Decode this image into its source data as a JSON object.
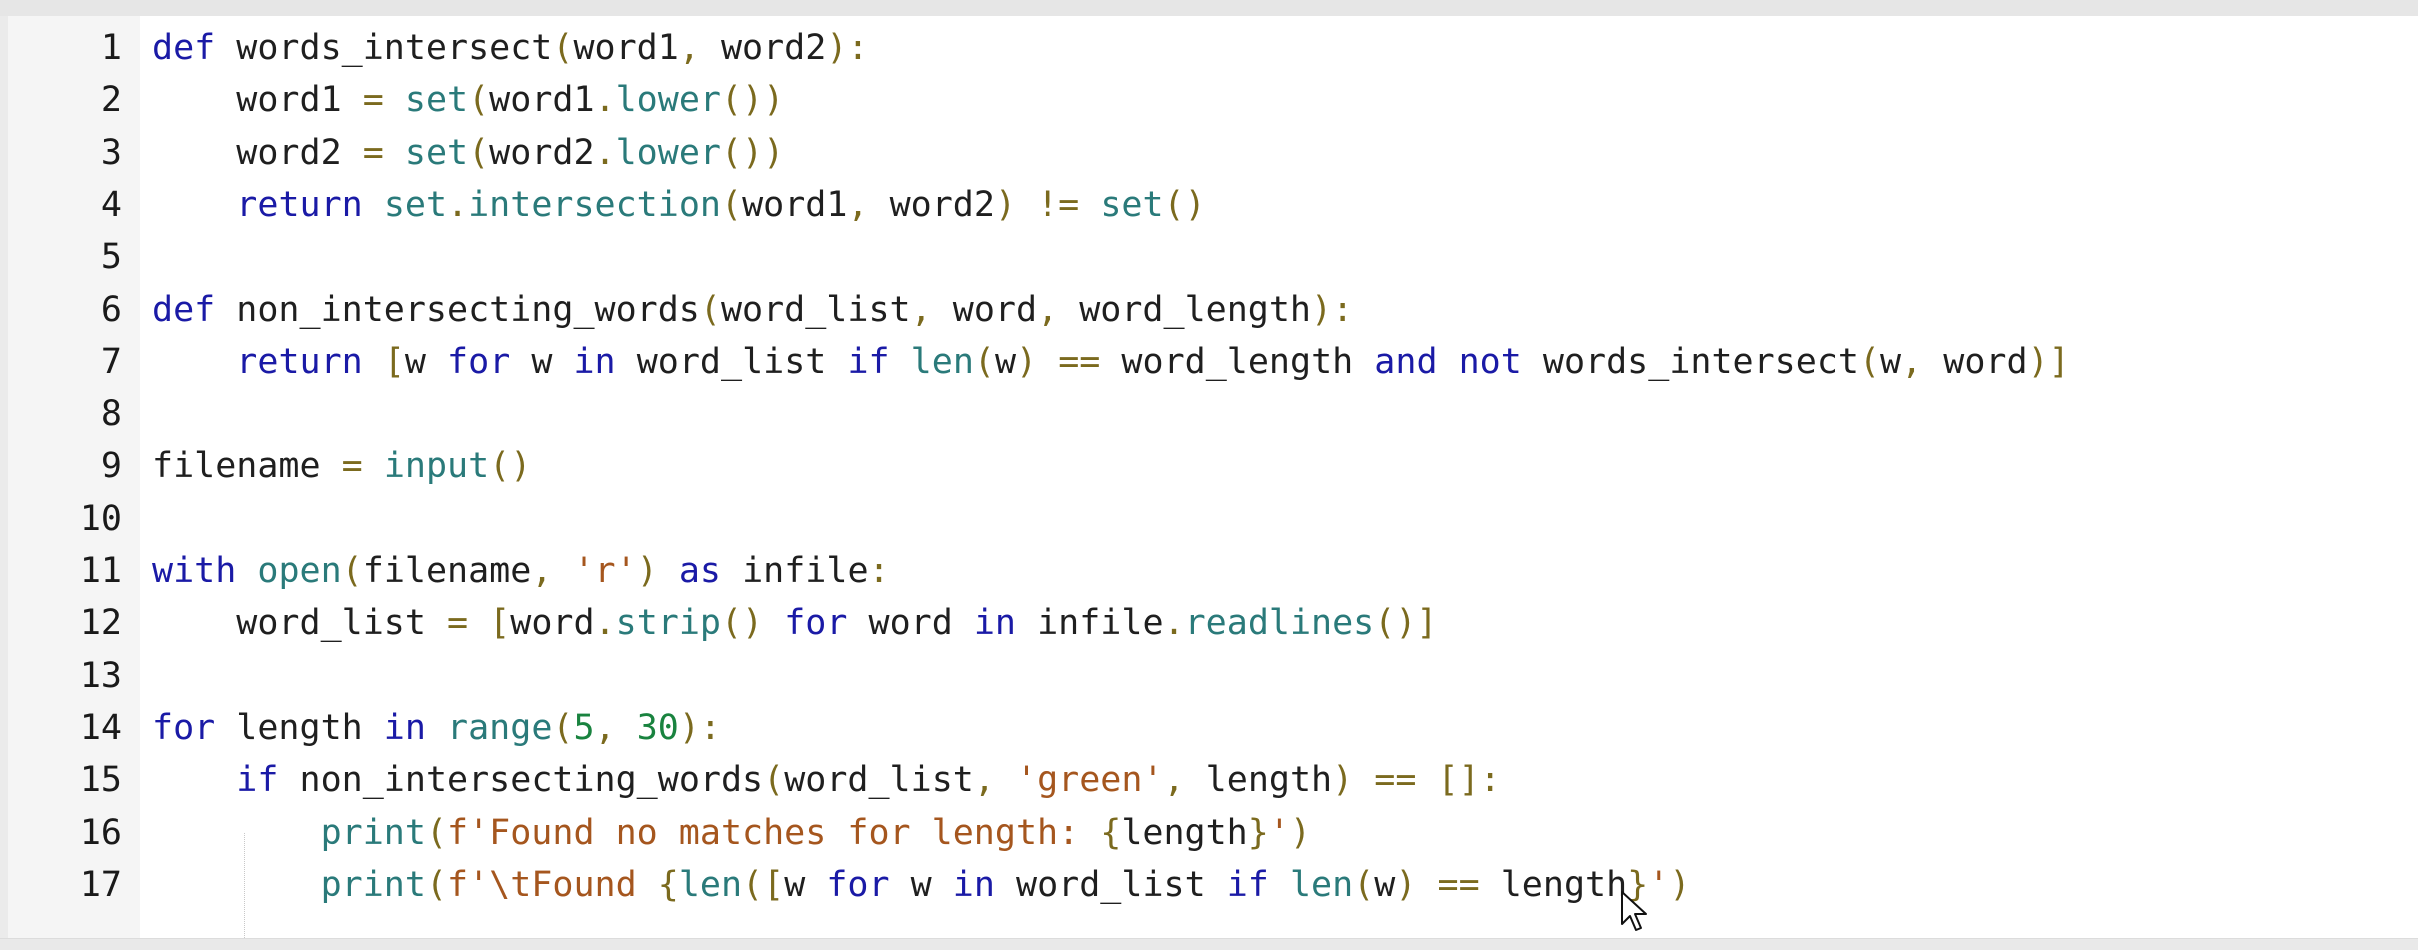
{
  "editor": {
    "lines": [
      {
        "num": "1",
        "tokens": [
          {
            "t": "def",
            "c": "kw"
          },
          {
            "t": " words_intersect",
            "c": "fn"
          },
          {
            "t": "(",
            "c": "pn"
          },
          {
            "t": "word1",
            "c": "tx"
          },
          {
            "t": ", ",
            "c": "pn"
          },
          {
            "t": "word2",
            "c": "tx"
          },
          {
            "t": "):",
            "c": "pn"
          }
        ]
      },
      {
        "num": "2",
        "tokens": [
          {
            "t": "    word1 ",
            "c": "tx"
          },
          {
            "t": "=",
            "c": "op"
          },
          {
            "t": " ",
            "c": "tx"
          },
          {
            "t": "set",
            "c": "bi"
          },
          {
            "t": "(",
            "c": "pn"
          },
          {
            "t": "word1",
            "c": "tx"
          },
          {
            "t": ".",
            "c": "pn"
          },
          {
            "t": "lower",
            "c": "bi"
          },
          {
            "t": "())",
            "c": "pn"
          }
        ]
      },
      {
        "num": "3",
        "tokens": [
          {
            "t": "    word2 ",
            "c": "tx"
          },
          {
            "t": "=",
            "c": "op"
          },
          {
            "t": " ",
            "c": "tx"
          },
          {
            "t": "set",
            "c": "bi"
          },
          {
            "t": "(",
            "c": "pn"
          },
          {
            "t": "word2",
            "c": "tx"
          },
          {
            "t": ".",
            "c": "pn"
          },
          {
            "t": "lower",
            "c": "bi"
          },
          {
            "t": "())",
            "c": "pn"
          }
        ]
      },
      {
        "num": "4",
        "tokens": [
          {
            "t": "    ",
            "c": "tx"
          },
          {
            "t": "return",
            "c": "kw"
          },
          {
            "t": " ",
            "c": "tx"
          },
          {
            "t": "set",
            "c": "bi"
          },
          {
            "t": ".",
            "c": "pn"
          },
          {
            "t": "intersection",
            "c": "bi"
          },
          {
            "t": "(",
            "c": "pn"
          },
          {
            "t": "word1",
            "c": "tx"
          },
          {
            "t": ", ",
            "c": "pn"
          },
          {
            "t": "word2",
            "c": "tx"
          },
          {
            "t": ") ",
            "c": "pn"
          },
          {
            "t": "!=",
            "c": "op"
          },
          {
            "t": " ",
            "c": "tx"
          },
          {
            "t": "set",
            "c": "bi"
          },
          {
            "t": "()",
            "c": "pn"
          }
        ]
      },
      {
        "num": "5",
        "tokens": []
      },
      {
        "num": "6",
        "tokens": [
          {
            "t": "def",
            "c": "kw"
          },
          {
            "t": " non_intersecting_words",
            "c": "fn"
          },
          {
            "t": "(",
            "c": "pn"
          },
          {
            "t": "word_list",
            "c": "tx"
          },
          {
            "t": ", ",
            "c": "pn"
          },
          {
            "t": "word",
            "c": "tx"
          },
          {
            "t": ", ",
            "c": "pn"
          },
          {
            "t": "word_length",
            "c": "tx"
          },
          {
            "t": "):",
            "c": "pn"
          }
        ]
      },
      {
        "num": "7",
        "tokens": [
          {
            "t": "    ",
            "c": "tx"
          },
          {
            "t": "return",
            "c": "kw"
          },
          {
            "t": " ",
            "c": "tx"
          },
          {
            "t": "[",
            "c": "pn"
          },
          {
            "t": "w ",
            "c": "tx"
          },
          {
            "t": "for",
            "c": "kw"
          },
          {
            "t": " w ",
            "c": "tx"
          },
          {
            "t": "in",
            "c": "kw"
          },
          {
            "t": " word_list ",
            "c": "tx"
          },
          {
            "t": "if",
            "c": "kw"
          },
          {
            "t": " ",
            "c": "tx"
          },
          {
            "t": "len",
            "c": "bi"
          },
          {
            "t": "(",
            "c": "pn"
          },
          {
            "t": "w",
            "c": "tx"
          },
          {
            "t": ") ",
            "c": "pn"
          },
          {
            "t": "==",
            "c": "op"
          },
          {
            "t": " word_length ",
            "c": "tx"
          },
          {
            "t": "and",
            "c": "kw"
          },
          {
            "t": " ",
            "c": "tx"
          },
          {
            "t": "not",
            "c": "kw"
          },
          {
            "t": " words_intersect",
            "c": "tx"
          },
          {
            "t": "(",
            "c": "pn"
          },
          {
            "t": "w",
            "c": "tx"
          },
          {
            "t": ", ",
            "c": "pn"
          },
          {
            "t": "word",
            "c": "tx"
          },
          {
            "t": ")]",
            "c": "pn"
          }
        ]
      },
      {
        "num": "8",
        "tokens": []
      },
      {
        "num": "9",
        "tokens": [
          {
            "t": "filename ",
            "c": "tx"
          },
          {
            "t": "=",
            "c": "op"
          },
          {
            "t": " ",
            "c": "tx"
          },
          {
            "t": "input",
            "c": "bi"
          },
          {
            "t": "()",
            "c": "pn"
          }
        ]
      },
      {
        "num": "10",
        "tokens": []
      },
      {
        "num": "11",
        "tokens": [
          {
            "t": "with",
            "c": "kw"
          },
          {
            "t": " ",
            "c": "tx"
          },
          {
            "t": "open",
            "c": "bi"
          },
          {
            "t": "(",
            "c": "pn"
          },
          {
            "t": "filename",
            "c": "tx"
          },
          {
            "t": ", ",
            "c": "pn"
          },
          {
            "t": "'r'",
            "c": "st"
          },
          {
            "t": ") ",
            "c": "pn"
          },
          {
            "t": "as",
            "c": "kw"
          },
          {
            "t": " infile",
            "c": "tx"
          },
          {
            "t": ":",
            "c": "pn"
          }
        ]
      },
      {
        "num": "12",
        "tokens": [
          {
            "t": "    word_list ",
            "c": "tx"
          },
          {
            "t": "=",
            "c": "op"
          },
          {
            "t": " ",
            "c": "tx"
          },
          {
            "t": "[",
            "c": "pn"
          },
          {
            "t": "word",
            "c": "tx"
          },
          {
            "t": ".",
            "c": "pn"
          },
          {
            "t": "strip",
            "c": "bi"
          },
          {
            "t": "() ",
            "c": "pn"
          },
          {
            "t": "for",
            "c": "kw"
          },
          {
            "t": " word ",
            "c": "tx"
          },
          {
            "t": "in",
            "c": "kw"
          },
          {
            "t": " infile",
            "c": "tx"
          },
          {
            "t": ".",
            "c": "pn"
          },
          {
            "t": "readlines",
            "c": "bi"
          },
          {
            "t": "()]",
            "c": "pn"
          }
        ]
      },
      {
        "num": "13",
        "tokens": []
      },
      {
        "num": "14",
        "tokens": [
          {
            "t": "for",
            "c": "kw"
          },
          {
            "t": " length ",
            "c": "tx"
          },
          {
            "t": "in",
            "c": "kw"
          },
          {
            "t": " ",
            "c": "tx"
          },
          {
            "t": "range",
            "c": "bi"
          },
          {
            "t": "(",
            "c": "pn"
          },
          {
            "t": "5",
            "c": "nm"
          },
          {
            "t": ", ",
            "c": "pn"
          },
          {
            "t": "30",
            "c": "nm"
          },
          {
            "t": "):",
            "c": "pn"
          }
        ]
      },
      {
        "num": "15",
        "tokens": [
          {
            "t": "    ",
            "c": "tx"
          },
          {
            "t": "if",
            "c": "kw"
          },
          {
            "t": " non_intersecting_words",
            "c": "tx"
          },
          {
            "t": "(",
            "c": "pn"
          },
          {
            "t": "word_list",
            "c": "tx"
          },
          {
            "t": ", ",
            "c": "pn"
          },
          {
            "t": "'green'",
            "c": "st"
          },
          {
            "t": ", ",
            "c": "pn"
          },
          {
            "t": "length",
            "c": "tx"
          },
          {
            "t": ") ",
            "c": "pn"
          },
          {
            "t": "==",
            "c": "op"
          },
          {
            "t": " ",
            "c": "tx"
          },
          {
            "t": "[]:",
            "c": "pn"
          }
        ]
      },
      {
        "num": "16",
        "tokens": [
          {
            "t": "        ",
            "c": "tx"
          },
          {
            "t": "print",
            "c": "bi"
          },
          {
            "t": "(",
            "c": "pn"
          },
          {
            "t": "f'Found no matches for length: ",
            "c": "st"
          },
          {
            "t": "{",
            "c": "pn"
          },
          {
            "t": "length",
            "c": "tx"
          },
          {
            "t": "}",
            "c": "pn"
          },
          {
            "t": "'",
            "c": "st"
          },
          {
            "t": ")",
            "c": "pn"
          }
        ]
      },
      {
        "num": "17",
        "tokens": [
          {
            "t": "        ",
            "c": "tx"
          },
          {
            "t": "print",
            "c": "bi"
          },
          {
            "t": "(",
            "c": "pn"
          },
          {
            "t": "f'\\tFound ",
            "c": "st"
          },
          {
            "t": "{",
            "c": "pn"
          },
          {
            "t": "len",
            "c": "bi"
          },
          {
            "t": "([",
            "c": "pn"
          },
          {
            "t": "w ",
            "c": "tx"
          },
          {
            "t": "for",
            "c": "kw"
          },
          {
            "t": " w ",
            "c": "tx"
          },
          {
            "t": "in",
            "c": "kw"
          },
          {
            "t": " word_list ",
            "c": "tx"
          },
          {
            "t": "if",
            "c": "kw"
          },
          {
            "t": " ",
            "c": "tx"
          },
          {
            "t": "len",
            "c": "bi"
          },
          {
            "t": "(",
            "c": "pn"
          },
          {
            "t": "w",
            "c": "tx"
          },
          {
            "t": ") ",
            "c": "pn"
          },
          {
            "t": "==",
            "c": "op"
          },
          {
            "t": " length",
            "c": "tx"
          },
          {
            "t": "}",
            "c": "pn"
          },
          {
            "t": "'",
            "c": "st"
          },
          {
            "t": ")",
            "c": "pn"
          }
        ]
      }
    ]
  },
  "cursor": {
    "icon": "mouse-pointer-icon"
  }
}
